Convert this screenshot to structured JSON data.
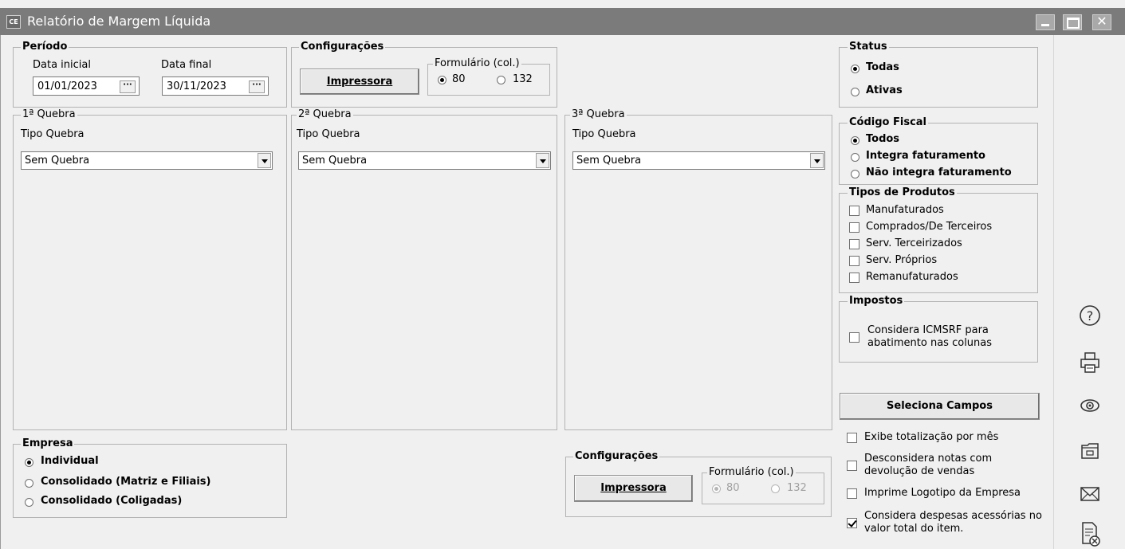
{
  "window": {
    "title": "Relatório de Margem Líquida",
    "app_icon_text": "CE"
  },
  "periodo": {
    "legend": "Período",
    "data_inicial_label": "Data inicial",
    "data_inicial_value": "01/01/2023",
    "data_final_label": "Data final",
    "data_final_value": "30/11/2023",
    "picker_glyph": "···"
  },
  "config_top": {
    "legend": "Configurações",
    "button_label": "Impressora",
    "formulario_legend": "Formulário (col.)",
    "opt_80": "80",
    "opt_132": "132"
  },
  "quebra1": {
    "legend": "1ª Quebra",
    "tipo_label": "Tipo Quebra",
    "value": "Sem Quebra"
  },
  "quebra2": {
    "legend": "2ª Quebra",
    "tipo_label": "Tipo Quebra",
    "value": "Sem Quebra"
  },
  "quebra3": {
    "legend": "3ª Quebra",
    "tipo_label": "Tipo Quebra",
    "value": "Sem Quebra"
  },
  "status": {
    "legend": "Status",
    "options": [
      "Todas",
      "Ativas"
    ],
    "selected": "Todas"
  },
  "codigo_fiscal": {
    "legend": "Código Fiscal",
    "options": [
      "Todos",
      "Integra faturamento",
      "Não integra faturamento"
    ],
    "selected": "Todos"
  },
  "tipos_produtos": {
    "legend": "Tipos de Produtos",
    "items": [
      "Manufaturados",
      "Comprados/De Terceiros",
      "Serv. Terceirizados",
      "Serv. Próprios",
      "Remanufaturados"
    ]
  },
  "impostos": {
    "legend": "Impostos",
    "check_line1": "Considera ICMSRF para",
    "check_line2": "abatimento nas colunas"
  },
  "seleciona_campos": "Seleciona Campos",
  "options": {
    "exibe_totalizacao": "Exibe totalização por mês",
    "desconsidera_line1": "Desconsidera notas com",
    "desconsidera_line2": "devolução de vendas",
    "imprime_logotipo": "Imprime Logotipo da Empresa",
    "considera_despesas_line1": "Considera despesas acessórias no",
    "considera_despesas_line2": "valor total do item.",
    "considera_despesas_checked": true
  },
  "empresa": {
    "legend": "Empresa",
    "options": [
      "Individual",
      "Consolidado (Matriz e Filiais)",
      "Consolidado (Coligadas)"
    ],
    "selected": "Individual"
  },
  "config_bottom": {
    "legend": "Configurações",
    "button_label": "Impressora",
    "formulario_legend": "Formulário (col.)",
    "opt_80": "80",
    "opt_132": "132",
    "disabled": true
  },
  "toolbar_icons": [
    "help-icon",
    "printer-icon",
    "preview-eye-icon",
    "folder-icon",
    "email-icon",
    "cancel-document-icon"
  ],
  "colors": {
    "titlebar": "#7b7b7b",
    "window_bg": "#f0f0f0",
    "group_border": "#b3b3b3"
  }
}
